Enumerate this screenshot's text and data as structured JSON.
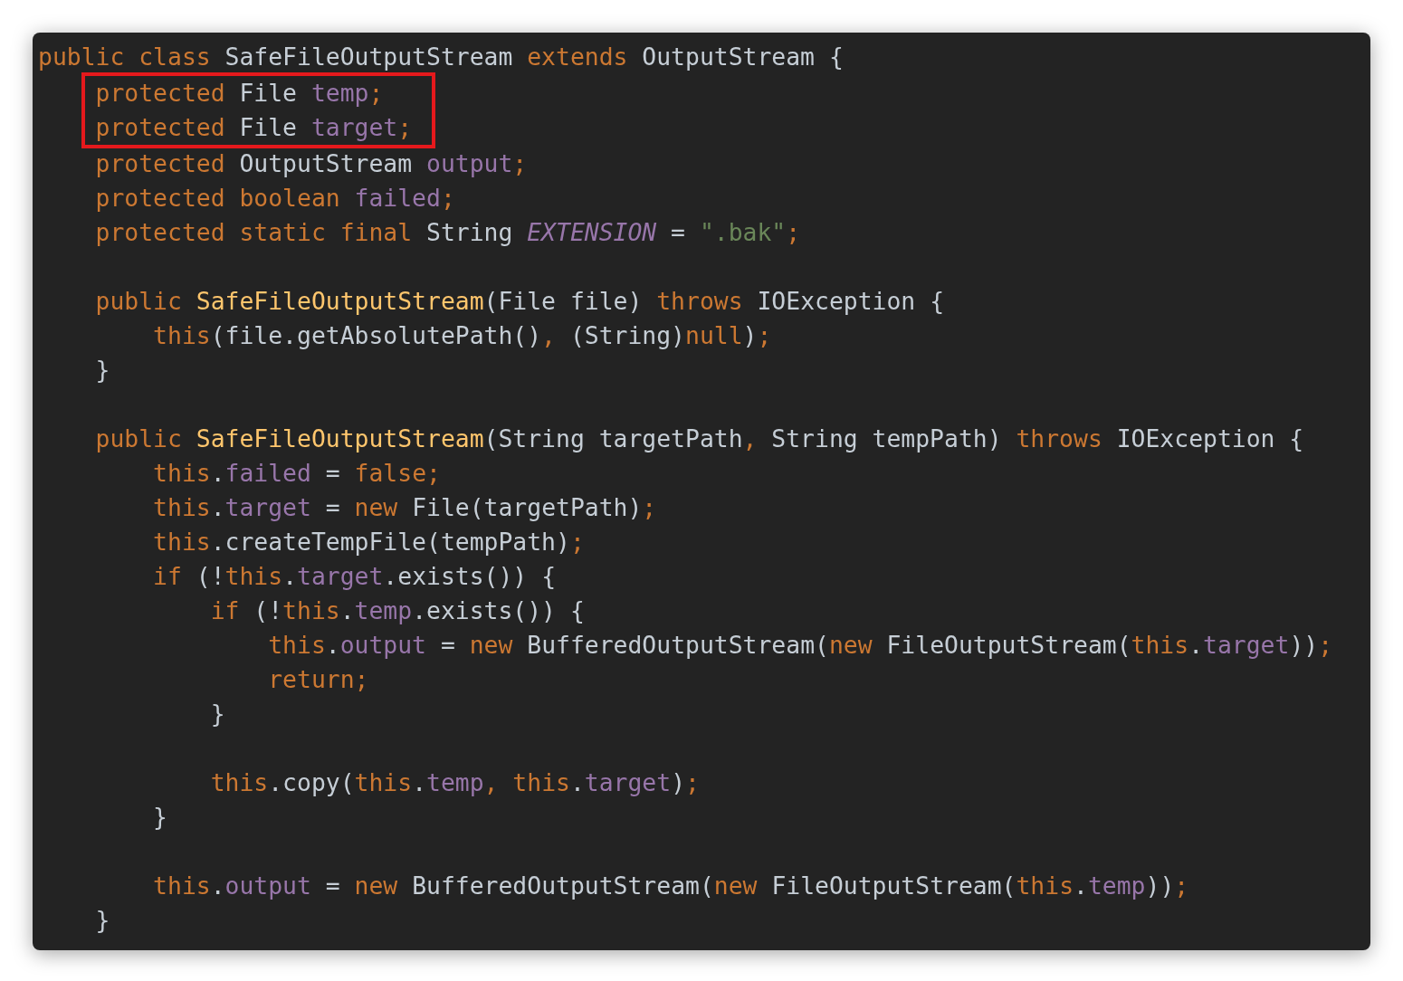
{
  "editor": {
    "blocks": [
      {
        "boxed": false,
        "lines": [
          {
            "kind": "code",
            "tokens": [
              {
                "text": "public class ",
                "kind": "keyword"
              },
              {
                "text": "SafeFileOutputStream ",
                "kind": "plain"
              },
              {
                "text": "extends ",
                "kind": "keyword"
              },
              {
                "text": "OutputStream {",
                "kind": "plain"
              }
            ]
          }
        ]
      },
      {
        "boxed": true,
        "lines": [
          {
            "kind": "code",
            "tokens": [
              {
                "text": "protected ",
                "kind": "keyword"
              },
              {
                "text": "File ",
                "kind": "plain"
              },
              {
                "text": "temp",
                "kind": "field"
              },
              {
                "text": ";",
                "kind": "keyword"
              }
            ]
          },
          {
            "kind": "code",
            "tokens": [
              {
                "text": "protected ",
                "kind": "keyword"
              },
              {
                "text": "File ",
                "kind": "plain"
              },
              {
                "text": "target",
                "kind": "field"
              },
              {
                "text": ";",
                "kind": "keyword"
              }
            ]
          }
        ]
      },
      {
        "boxed": false,
        "lines": [
          {
            "kind": "code",
            "tokens": [
              {
                "text": "    protected ",
                "kind": "keyword"
              },
              {
                "text": "OutputStream ",
                "kind": "plain"
              },
              {
                "text": "output",
                "kind": "field"
              },
              {
                "text": ";",
                "kind": "keyword"
              }
            ]
          },
          {
            "kind": "code",
            "tokens": [
              {
                "text": "    protected boolean ",
                "kind": "keyword"
              },
              {
                "text": "failed",
                "kind": "field"
              },
              {
                "text": ";",
                "kind": "keyword"
              }
            ]
          },
          {
            "kind": "code",
            "tokens": [
              {
                "text": "    protected static final ",
                "kind": "keyword"
              },
              {
                "text": "String ",
                "kind": "plain"
              },
              {
                "text": "EXTENSION",
                "kind": "constant"
              },
              {
                "text": " = ",
                "kind": "plain"
              },
              {
                "text": "\".bak\"",
                "kind": "string"
              },
              {
                "text": ";",
                "kind": "keyword"
              }
            ]
          },
          {
            "kind": "blank"
          },
          {
            "kind": "code",
            "tokens": [
              {
                "text": "    public ",
                "kind": "keyword"
              },
              {
                "text": "SafeFileOutputStream",
                "kind": "method"
              },
              {
                "text": "(File file) ",
                "kind": "plain"
              },
              {
                "text": "throws ",
                "kind": "keyword"
              },
              {
                "text": "IOException {",
                "kind": "plain"
              }
            ]
          },
          {
            "kind": "code",
            "tokens": [
              {
                "text": "        this",
                "kind": "keyword"
              },
              {
                "text": "(file.getAbsolutePath()",
                "kind": "plain"
              },
              {
                "text": ", ",
                "kind": "keyword"
              },
              {
                "text": "(String)",
                "kind": "plain"
              },
              {
                "text": "null",
                "kind": "keyword"
              },
              {
                "text": ")",
                "kind": "plain"
              },
              {
                "text": ";",
                "kind": "keyword"
              }
            ]
          },
          {
            "kind": "code",
            "tokens": [
              {
                "text": "    }",
                "kind": "plain"
              }
            ]
          },
          {
            "kind": "blank"
          },
          {
            "kind": "code",
            "tokens": [
              {
                "text": "    public ",
                "kind": "keyword"
              },
              {
                "text": "SafeFileOutputStream",
                "kind": "method"
              },
              {
                "text": "(String targetPath",
                "kind": "plain"
              },
              {
                "text": ", ",
                "kind": "keyword"
              },
              {
                "text": "String tempPath) ",
                "kind": "plain"
              },
              {
                "text": "throws ",
                "kind": "keyword"
              },
              {
                "text": "IOException {",
                "kind": "plain"
              }
            ]
          },
          {
            "kind": "code",
            "tokens": [
              {
                "text": "        this",
                "kind": "keyword"
              },
              {
                "text": ".",
                "kind": "plain"
              },
              {
                "text": "failed",
                "kind": "field"
              },
              {
                "text": " = ",
                "kind": "plain"
              },
              {
                "text": "false;",
                "kind": "keyword"
              }
            ]
          },
          {
            "kind": "code",
            "tokens": [
              {
                "text": "        this",
                "kind": "keyword"
              },
              {
                "text": ".",
                "kind": "plain"
              },
              {
                "text": "target",
                "kind": "field"
              },
              {
                "text": " = ",
                "kind": "plain"
              },
              {
                "text": "new ",
                "kind": "keyword"
              },
              {
                "text": "File(targetPath)",
                "kind": "plain"
              },
              {
                "text": ";",
                "kind": "keyword"
              }
            ]
          },
          {
            "kind": "code",
            "tokens": [
              {
                "text": "        this",
                "kind": "keyword"
              },
              {
                "text": ".createTempFile(tempPath)",
                "kind": "plain"
              },
              {
                "text": ";",
                "kind": "keyword"
              }
            ]
          },
          {
            "kind": "code",
            "tokens": [
              {
                "text": "        if ",
                "kind": "keyword"
              },
              {
                "text": "(!",
                "kind": "plain"
              },
              {
                "text": "this",
                "kind": "keyword"
              },
              {
                "text": ".",
                "kind": "plain"
              },
              {
                "text": "target",
                "kind": "field"
              },
              {
                "text": ".exists()) {",
                "kind": "plain"
              }
            ]
          },
          {
            "kind": "code",
            "tokens": [
              {
                "text": "            if ",
                "kind": "keyword"
              },
              {
                "text": "(!",
                "kind": "plain"
              },
              {
                "text": "this",
                "kind": "keyword"
              },
              {
                "text": ".",
                "kind": "plain"
              },
              {
                "text": "temp",
                "kind": "field"
              },
              {
                "text": ".exists()) {",
                "kind": "plain"
              }
            ]
          },
          {
            "kind": "code",
            "tokens": [
              {
                "text": "                this",
                "kind": "keyword"
              },
              {
                "text": ".",
                "kind": "plain"
              },
              {
                "text": "output",
                "kind": "field"
              },
              {
                "text": " = ",
                "kind": "plain"
              },
              {
                "text": "new ",
                "kind": "keyword"
              },
              {
                "text": "BufferedOutputStream(",
                "kind": "plain"
              },
              {
                "text": "new ",
                "kind": "keyword"
              },
              {
                "text": "FileOutputStream(",
                "kind": "plain"
              },
              {
                "text": "this",
                "kind": "keyword"
              },
              {
                "text": ".",
                "kind": "plain"
              },
              {
                "text": "target",
                "kind": "field"
              },
              {
                "text": "))",
                "kind": "plain"
              },
              {
                "text": ";",
                "kind": "keyword"
              }
            ]
          },
          {
            "kind": "code",
            "tokens": [
              {
                "text": "                return;",
                "kind": "keyword"
              }
            ]
          },
          {
            "kind": "code",
            "tokens": [
              {
                "text": "            }",
                "kind": "plain"
              }
            ]
          },
          {
            "kind": "blank"
          },
          {
            "kind": "code",
            "tokens": [
              {
                "text": "            this",
                "kind": "keyword"
              },
              {
                "text": ".copy(",
                "kind": "plain"
              },
              {
                "text": "this",
                "kind": "keyword"
              },
              {
                "text": ".",
                "kind": "plain"
              },
              {
                "text": "temp",
                "kind": "field"
              },
              {
                "text": ", this",
                "kind": "keyword"
              },
              {
                "text": ".",
                "kind": "plain"
              },
              {
                "text": "target",
                "kind": "field"
              },
              {
                "text": ")",
                "kind": "plain"
              },
              {
                "text": ";",
                "kind": "keyword"
              }
            ]
          },
          {
            "kind": "code",
            "tokens": [
              {
                "text": "        }",
                "kind": "plain"
              }
            ]
          },
          {
            "kind": "blank"
          },
          {
            "kind": "code",
            "tokens": [
              {
                "text": "        this",
                "kind": "keyword"
              },
              {
                "text": ".",
                "kind": "plain"
              },
              {
                "text": "output",
                "kind": "field"
              },
              {
                "text": " = ",
                "kind": "plain"
              },
              {
                "text": "new ",
                "kind": "keyword"
              },
              {
                "text": "BufferedOutputStream(",
                "kind": "plain"
              },
              {
                "text": "new ",
                "kind": "keyword"
              },
              {
                "text": "FileOutputStream(",
                "kind": "plain"
              },
              {
                "text": "this",
                "kind": "keyword"
              },
              {
                "text": ".",
                "kind": "plain"
              },
              {
                "text": "temp",
                "kind": "field"
              },
              {
                "text": "))",
                "kind": "plain"
              },
              {
                "text": ";",
                "kind": "keyword"
              }
            ]
          },
          {
            "kind": "code",
            "tokens": [
              {
                "text": "    }",
                "kind": "plain"
              }
            ]
          }
        ]
      }
    ]
  }
}
